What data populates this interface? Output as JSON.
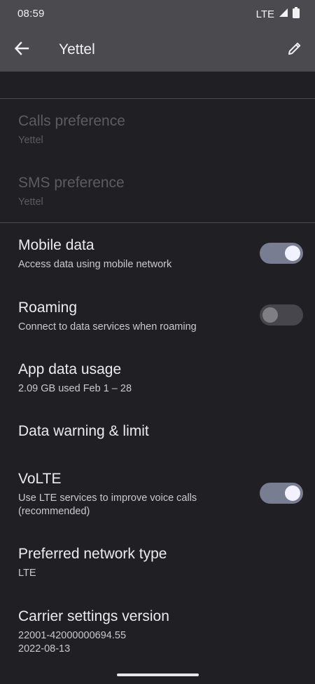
{
  "status_bar": {
    "time": "08:59",
    "network": "LTE",
    "icons": [
      "signal-icon",
      "battery-icon"
    ]
  },
  "app_bar": {
    "title": "Yettel",
    "back_icon": "arrow-back-icon",
    "edit_icon": "pencil-icon"
  },
  "colors": {
    "app_bar_bg": "#4a4a4f",
    "page_bg": "#1f1f24",
    "toggle_on_track": "#797d91",
    "toggle_off_track": "#46464c"
  },
  "preferences": {
    "calls": {
      "title": "Calls preference",
      "summary": "Yettel",
      "enabled": false
    },
    "sms": {
      "title": "SMS preference",
      "summary": "Yettel",
      "enabled": false
    },
    "mobile_data": {
      "title": "Mobile data",
      "summary": "Access data using mobile network",
      "toggle": true
    },
    "roaming": {
      "title": "Roaming",
      "summary": "Connect to data services when roaming",
      "toggle": false
    },
    "app_data_usage": {
      "title": "App data usage",
      "summary": "2.09 GB used Feb 1 – 28"
    },
    "data_warning": {
      "title": "Data warning & limit"
    },
    "volte": {
      "title": "VoLTE",
      "summary": "Use LTE services to improve voice calls\n(recommended)",
      "toggle": true
    },
    "network_type": {
      "title": "Preferred network type",
      "summary": "LTE"
    },
    "carrier_version": {
      "title": "Carrier settings version",
      "summary": "22001-42000000694.55\n2022-08-13"
    }
  }
}
